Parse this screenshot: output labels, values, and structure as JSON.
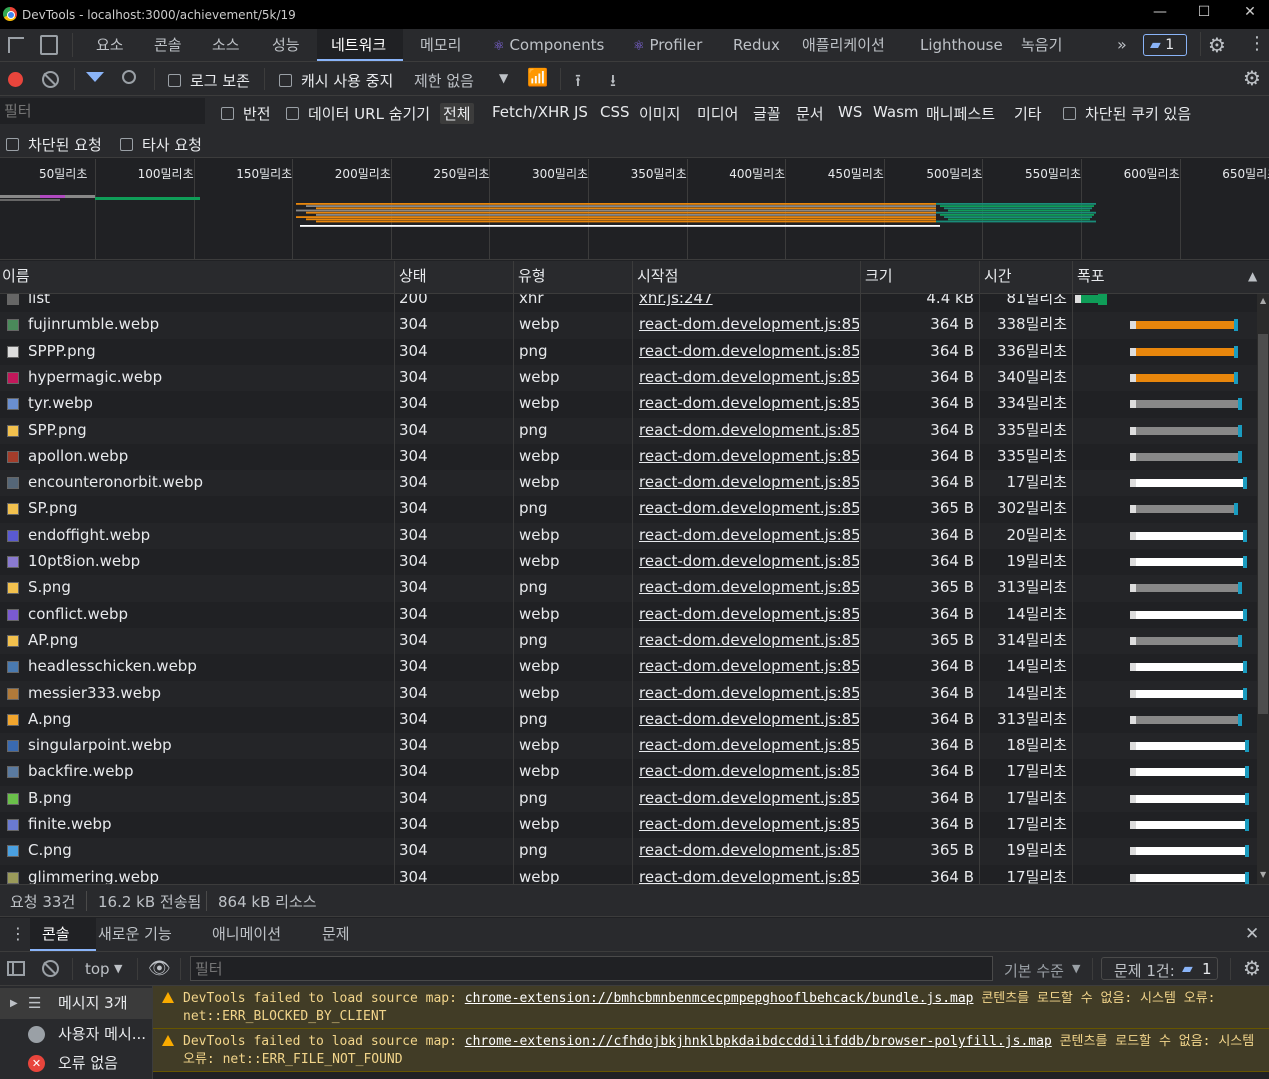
{
  "window": {
    "title": "DevTools - localhost:3000/achievement/5k/19"
  },
  "tabs": [
    {
      "label": "요소"
    },
    {
      "label": "콘솔"
    },
    {
      "label": "소스"
    },
    {
      "label": "성능"
    },
    {
      "label": "네트워크",
      "active": true
    },
    {
      "label": "메모리"
    },
    {
      "label": "Components"
    },
    {
      "label": "Profiler"
    },
    {
      "label": "Redux"
    },
    {
      "label": "애플리케이션"
    },
    {
      "label": "Lighthouse"
    },
    {
      "label": "녹음기"
    }
  ],
  "issues_badge": "1",
  "toolbar": {
    "preserve_log": "로그 보존",
    "disable_cache": "캐시 사용 중지",
    "throttling": "제한 없음"
  },
  "filter": {
    "placeholder": "필터",
    "invert": "반전",
    "hide_data_urls": "데이터 URL 숨기기",
    "types": [
      "전체",
      "Fetch/XHR",
      "JS",
      "CSS",
      "이미지",
      "미디어",
      "글꼴",
      "문서",
      "WS",
      "Wasm",
      "매니페스트",
      "기타"
    ],
    "blocked_cookies": "차단된 쿠키 있음",
    "blocked_requests": "차단된 요청",
    "third_party": "타사 요청"
  },
  "overview": {
    "ticks": [
      "50밀리초",
      "100밀리초",
      "150밀리초",
      "200밀리초",
      "250밀리초",
      "300밀리초",
      "350밀리초",
      "400밀리초",
      "450밀리초",
      "500밀리초",
      "550밀리초",
      "600밀리초",
      "650밀리초"
    ]
  },
  "table": {
    "headers": {
      "name": "이름",
      "status": "상태",
      "type": "유형",
      "initiator": "시작점",
      "size": "크기",
      "time": "시간",
      "waterfall": "폭포"
    },
    "rows": [
      {
        "name": "list",
        "status": "200",
        "type": "xhr",
        "initiator": "xhr.js:247",
        "size": "4.4 kB",
        "time": "81밀리초",
        "icon_color": "#666666",
        "wf_start": 0.02,
        "wf_wait": 0.1,
        "wf_color": "#0f9d58",
        "wf_download": 0.1
      },
      {
        "name": "fujinrumble.webp",
        "status": "304",
        "type": "webp",
        "initiator": "react-dom.development.js:855",
        "size": "364 B",
        "time": "338밀리초",
        "icon_color": "#4a8a5a",
        "wf_start": 0.34,
        "wf_wait": 0.58,
        "wf_color": "#e8860c",
        "wf_download": 0.04
      },
      {
        "name": "SPPP.png",
        "status": "304",
        "type": "png",
        "initiator": "react-dom.development.js:855",
        "size": "364 B",
        "time": "336밀리초",
        "icon_color": "#dddddd",
        "wf_start": 0.34,
        "wf_wait": 0.58,
        "wf_color": "#e8860c",
        "wf_download": 0.03
      },
      {
        "name": "hypermagic.webp",
        "status": "304",
        "type": "webp",
        "initiator": "react-dom.development.js:855",
        "size": "364 B",
        "time": "340밀리초",
        "icon_color": "#c2185b",
        "wf_start": 0.34,
        "wf_wait": 0.58,
        "wf_color": "#e8860c",
        "wf_download": 0.03
      },
      {
        "name": "tyr.webp",
        "status": "304",
        "type": "webp",
        "initiator": "react-dom.development.js:855",
        "size": "364 B",
        "time": "334밀리초",
        "icon_color": "#6a8fd0",
        "wf_start": 0.34,
        "wf_wait": 0.6,
        "wf_color": "#888888",
        "wf_download": 0.03
      },
      {
        "name": "SPP.png",
        "status": "304",
        "type": "png",
        "initiator": "react-dom.development.js:855",
        "size": "364 B",
        "time": "335밀리초",
        "icon_color": "#f2c14e",
        "wf_start": 0.34,
        "wf_wait": 0.6,
        "wf_color": "#888888",
        "wf_download": 0.03
      },
      {
        "name": "apollon.webp",
        "status": "304",
        "type": "webp",
        "initiator": "react-dom.development.js:855",
        "size": "364 B",
        "time": "335밀리초",
        "icon_color": "#a33d2b",
        "wf_start": 0.34,
        "wf_wait": 0.6,
        "wf_color": "#888888",
        "wf_download": 0.03
      },
      {
        "name": "encounteronorbit.webp",
        "status": "304",
        "type": "webp",
        "initiator": "react-dom.development.js:855",
        "size": "364 B",
        "time": "17밀리초",
        "icon_color": "#556677",
        "wf_start": 0.34,
        "wf_wait": 0.63,
        "wf_color": "#ffffff",
        "wf_download": 0.03
      },
      {
        "name": "SP.png",
        "status": "304",
        "type": "png",
        "initiator": "react-dom.development.js:855",
        "size": "365 B",
        "time": "302밀리초",
        "icon_color": "#f2c14e",
        "wf_start": 0.34,
        "wf_wait": 0.58,
        "wf_color": "#888888",
        "wf_download": 0.03
      },
      {
        "name": "endoffight.webp",
        "status": "304",
        "type": "webp",
        "initiator": "react-dom.development.js:855",
        "size": "364 B",
        "time": "20밀리초",
        "icon_color": "#5a5ad0",
        "wf_start": 0.34,
        "wf_wait": 0.63,
        "wf_color": "#ffffff",
        "wf_download": 0.03
      },
      {
        "name": "10pt8ion.webp",
        "status": "304",
        "type": "webp",
        "initiator": "react-dom.development.js:855",
        "size": "364 B",
        "time": "19밀리초",
        "icon_color": "#8a7ad0",
        "wf_start": 0.34,
        "wf_wait": 0.63,
        "wf_color": "#ffffff",
        "wf_download": 0.03
      },
      {
        "name": "S.png",
        "status": "304",
        "type": "png",
        "initiator": "react-dom.development.js:855",
        "size": "365 B",
        "time": "313밀리초",
        "icon_color": "#f2c14e",
        "wf_start": 0.34,
        "wf_wait": 0.6,
        "wf_color": "#888888",
        "wf_download": 0.03
      },
      {
        "name": "conflict.webp",
        "status": "304",
        "type": "webp",
        "initiator": "react-dom.development.js:855",
        "size": "364 B",
        "time": "14밀리초",
        "icon_color": "#7a5ad0",
        "wf_start": 0.34,
        "wf_wait": 0.63,
        "wf_color": "#ffffff",
        "wf_download": 0.03
      },
      {
        "name": "AP.png",
        "status": "304",
        "type": "png",
        "initiator": "react-dom.development.js:855",
        "size": "365 B",
        "time": "314밀리초",
        "icon_color": "#f2c14e",
        "wf_start": 0.34,
        "wf_wait": 0.6,
        "wf_color": "#888888",
        "wf_download": 0.03
      },
      {
        "name": "headlesschicken.webp",
        "status": "304",
        "type": "webp",
        "initiator": "react-dom.development.js:855",
        "size": "364 B",
        "time": "14밀리초",
        "icon_color": "#4a7ab0",
        "wf_start": 0.34,
        "wf_wait": 0.63,
        "wf_color": "#ffffff",
        "wf_download": 0.03
      },
      {
        "name": "messier333.webp",
        "status": "304",
        "type": "webp",
        "initiator": "react-dom.development.js:855",
        "size": "364 B",
        "time": "14밀리초",
        "icon_color": "#b07a3a",
        "wf_start": 0.34,
        "wf_wait": 0.63,
        "wf_color": "#ffffff",
        "wf_download": 0.03
      },
      {
        "name": "A.png",
        "status": "304",
        "type": "png",
        "initiator": "react-dom.development.js:855",
        "size": "364 B",
        "time": "313밀리초",
        "icon_color": "#f2a62e",
        "wf_start": 0.34,
        "wf_wait": 0.6,
        "wf_color": "#888888",
        "wf_download": 0.03
      },
      {
        "name": "singularpoint.webp",
        "status": "304",
        "type": "webp",
        "initiator": "react-dom.development.js:855",
        "size": "364 B",
        "time": "18밀리초",
        "icon_color": "#3a6ab0",
        "wf_start": 0.34,
        "wf_wait": 0.64,
        "wf_color": "#ffffff",
        "wf_download": 0.03
      },
      {
        "name": "backfire.webp",
        "status": "304",
        "type": "webp",
        "initiator": "react-dom.development.js:855",
        "size": "364 B",
        "time": "17밀리초",
        "icon_color": "#5a7aa0",
        "wf_start": 0.34,
        "wf_wait": 0.64,
        "wf_color": "#ffffff",
        "wf_download": 0.03
      },
      {
        "name": "B.png",
        "status": "304",
        "type": "png",
        "initiator": "react-dom.development.js:855",
        "size": "364 B",
        "time": "17밀리초",
        "icon_color": "#6ac04a",
        "wf_start": 0.34,
        "wf_wait": 0.64,
        "wf_color": "#ffffff",
        "wf_download": 0.03
      },
      {
        "name": "finite.webp",
        "status": "304",
        "type": "webp",
        "initiator": "react-dom.development.js:855",
        "size": "364 B",
        "time": "17밀리초",
        "icon_color": "#6a7ad0",
        "wf_start": 0.34,
        "wf_wait": 0.64,
        "wf_color": "#ffffff",
        "wf_download": 0.03
      },
      {
        "name": "C.png",
        "status": "304",
        "type": "png",
        "initiator": "react-dom.development.js:855",
        "size": "365 B",
        "time": "19밀리초",
        "icon_color": "#4aa0e0",
        "wf_start": 0.34,
        "wf_wait": 0.64,
        "wf_color": "#ffffff",
        "wf_download": 0.03
      },
      {
        "name": "glimmering.webp",
        "status": "304",
        "type": "webp",
        "initiator": "react-dom.development.js:855",
        "size": "364 B",
        "time": "17밀리초",
        "icon_color": "#9a9a5a",
        "wf_start": 0.34,
        "wf_wait": 0.64,
        "wf_color": "#ffffff",
        "wf_download": 0.03
      }
    ]
  },
  "status": {
    "requests": "요청 33건",
    "transferred": "16.2 kB 전송됨",
    "resources": "864 kB 리소스"
  },
  "drawer": {
    "tabs": [
      "콘솔",
      "새로운 기능",
      "애니메이션",
      "문제"
    ],
    "context": "top",
    "filter_placeholder": "필터",
    "levels": "기본 수준",
    "issues": "문제 1건:",
    "issues_count": "1"
  },
  "console_sidebar": [
    {
      "label": "메시지 3개"
    },
    {
      "label": "사용자 메시..."
    },
    {
      "label": "오류 없음"
    }
  ],
  "console_messages": [
    {
      "prefix": "DevTools failed to load source map: ",
      "url": "chrome-extension://bmhcbmnbenmcecpmpepghooflbehcack/bundle.js.map",
      "suffix": " 콘텐츠를 로드할 수 없음: 시스템 오류: net::ERR_BLOCKED_BY_CLIENT"
    },
    {
      "prefix": "DevTools failed to load source map: ",
      "url": "chrome-extension://cfhdojbkjhnklbpkdaibdccddilifddb/browser-polyfill.js.map",
      "suffix": " 콘텐츠를 로드할 수 없음: 시스템 오류: net::ERR_FILE_NOT_FOUND"
    }
  ],
  "colors": {
    "accent": "#8ab4f8",
    "warning_bg": "#413c26",
    "warning_text": "#f2d58b",
    "error": "#e8453c"
  }
}
